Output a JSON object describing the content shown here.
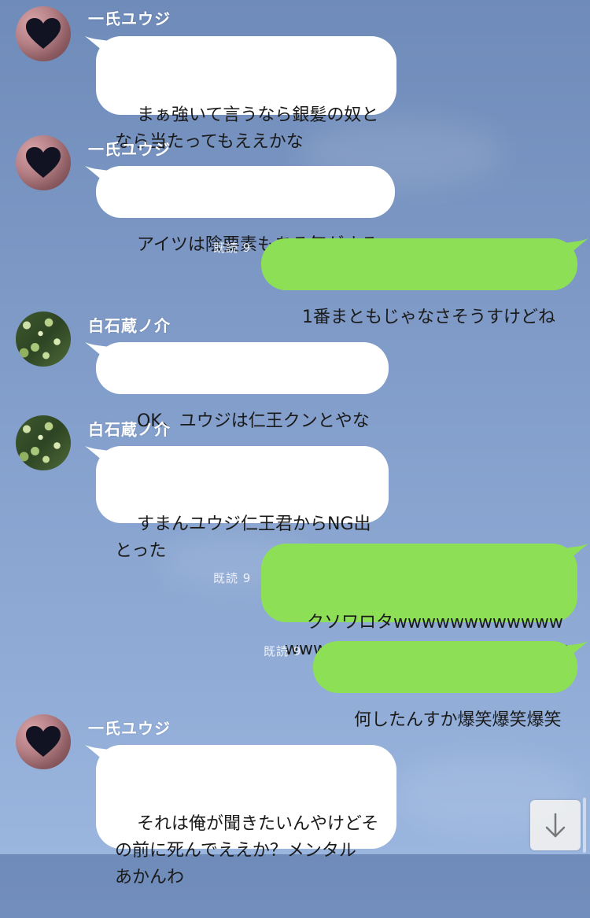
{
  "messages": [
    {
      "sender": "一氏ユウジ",
      "text": "まぁ強いて言うなら銀髪の奴と\nなら当たってもええかな"
    },
    {
      "sender": "一氏ユウジ",
      "text": "アイツは陰要素もある気がする"
    },
    {
      "read": "既読 9",
      "text": "1番まともじゃなさそうすけどね"
    },
    {
      "sender": "白石蔵ノ介",
      "text": "OK、ユウジは仁王クンとやな"
    },
    {
      "sender": "白石蔵ノ介",
      "text": "すまんユウジ仁王君からNG出\nとった"
    },
    {
      "read": "既読 9",
      "text": "クソワロタwwwwwwwwwwww\nwwwwwwwwwwwwwwwwwwww"
    },
    {
      "read": "既読 9",
      "text": "何したんすか爆笑爆笑爆笑"
    },
    {
      "sender": "一氏ユウジ",
      "text": "それは俺が聞きたいんやけどそ\nの前に死んでええか？メンタル\nあかんわ"
    }
  ],
  "icons": {
    "avatar_yuji": "heart-photo-avatar-icon",
    "avatar_shiraishi": "foliage-photo-avatar-icon",
    "scroll_down": "down-arrow-icon"
  },
  "colors": {
    "incoming_bubble": "#ffffff",
    "outgoing_bubble": "#8de055",
    "background": "#7e99c6"
  }
}
